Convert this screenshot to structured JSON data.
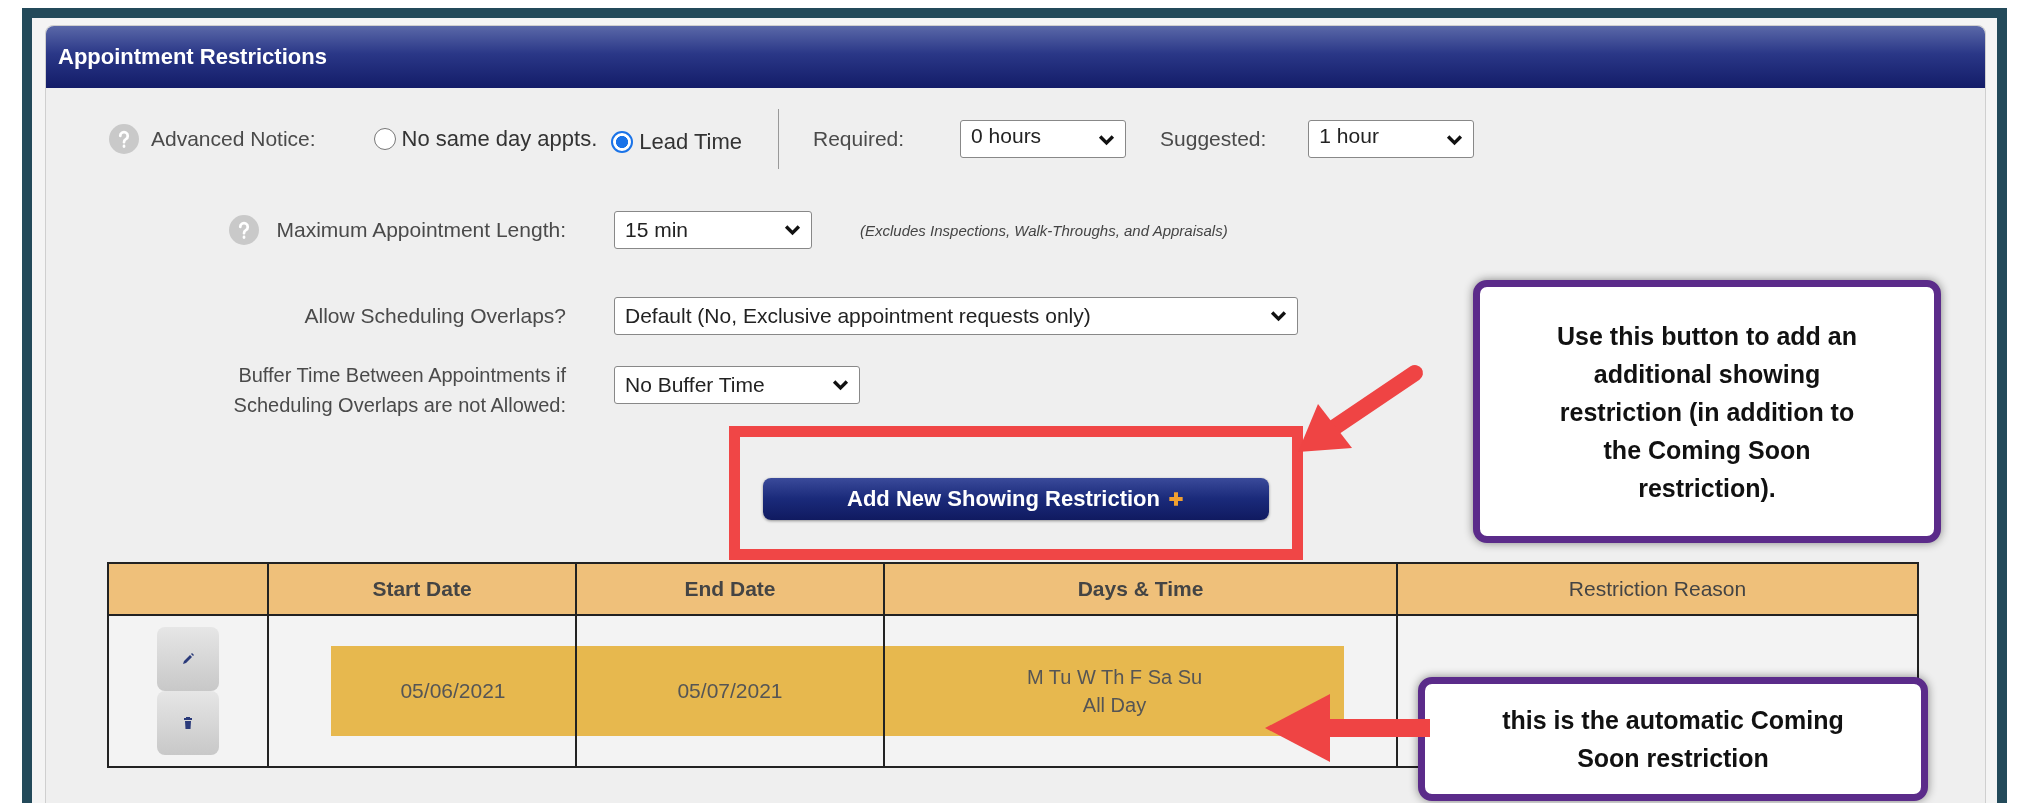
{
  "panel": {
    "title": "Appointment Restrictions"
  },
  "advanced_notice": {
    "label": "Advanced Notice:",
    "options": [
      {
        "label": "No same day appts.",
        "selected": false
      },
      {
        "label": "Lead Time",
        "selected": true
      }
    ],
    "required_label": "Required:",
    "required_value": "0 hours",
    "suggested_label": "Suggested:",
    "suggested_value": "1 hour"
  },
  "max_length": {
    "label": "Maximum Appointment Length:",
    "value": "15 min",
    "note": "(Excludes Inspections, Walk-Throughs, and Appraisals)"
  },
  "overlaps": {
    "label": "Allow Scheduling Overlaps?",
    "value": "Default (No, Exclusive appointment requests only)"
  },
  "buffer": {
    "label": "Buffer Time Between Appointments if\nScheduling Overlaps are not Allowed:",
    "value": "No Buffer Time"
  },
  "add_button": {
    "label": "Add New Showing Restriction"
  },
  "table": {
    "columns": [
      "Start Date",
      "End Date",
      "Days & Time",
      "Restriction Reason"
    ],
    "rows": [
      {
        "start": "05/06/2021",
        "end": "05/07/2021",
        "days": "M Tu W Th F Sa Su",
        "time": "All Day",
        "highlighted": true
      }
    ]
  },
  "callouts": [
    {
      "text": "Use this button to add an additional showing restriction (in addition to the Coming Soon restriction)."
    },
    {
      "text": "this is the automatic Coming Soon restriction"
    }
  ]
}
